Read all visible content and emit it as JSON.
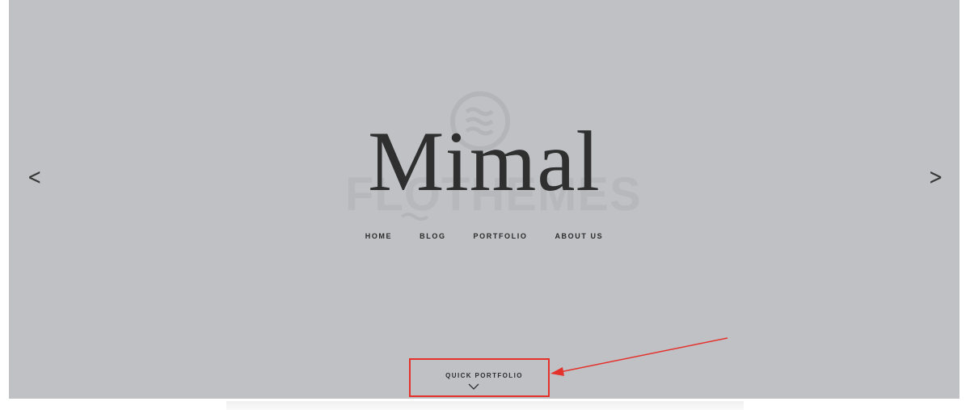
{
  "site": {
    "logo": "Mimal",
    "watermark": "FLOTHEMES"
  },
  "nav": {
    "items": [
      {
        "label": "HOME"
      },
      {
        "label": "BLOG"
      },
      {
        "label": "PORTFOLIO"
      },
      {
        "label": "ABOUT US"
      }
    ]
  },
  "slider": {
    "prev_label": "<",
    "next_label": ">"
  },
  "quick_portfolio": {
    "label": "QUICK PORTFOLIO"
  },
  "icons": {
    "prev": "chevron-left-icon",
    "next": "chevron-right-icon",
    "scroll": "chevron-down-icon",
    "watermark": "flothemes-logo-icon"
  },
  "colors": {
    "hero_background": "#bfc1c5",
    "text": "#2f2f30",
    "annotation": "#e4322b"
  }
}
